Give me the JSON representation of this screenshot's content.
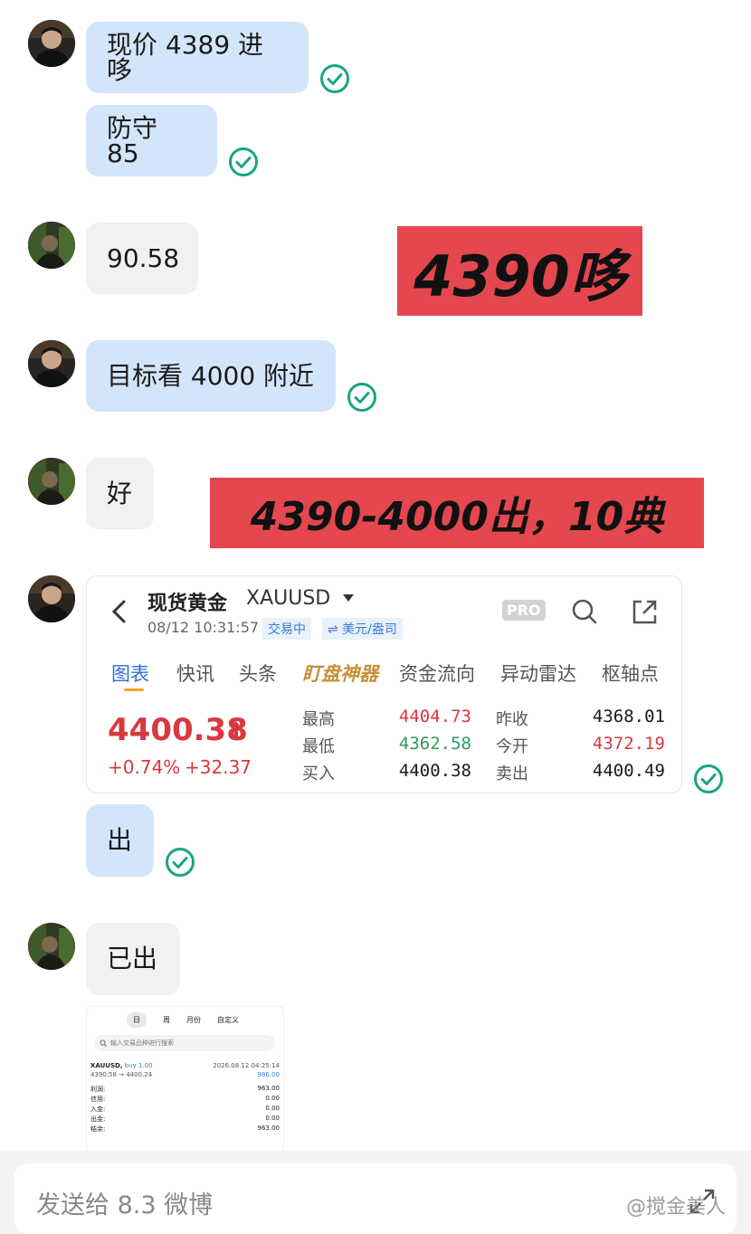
{
  "messages": {
    "m1": "现价 4389 进哆",
    "m2": "防守 85",
    "m3": "90.58",
    "m4": "目标看 4000 附近",
    "m5": "好",
    "m6": "出",
    "m7": "已出"
  },
  "banners": {
    "b1": "4390哆",
    "b2": "4390-4000出，10典"
  },
  "quote_card": {
    "title": "现货黄金",
    "symbol": "XAUUSD",
    "timestamp": "08/12 10:31:57",
    "badge_trading": "交易中",
    "badge_unit": "⇌ 美元/盎司",
    "pro_label": "PRO",
    "tabs": [
      "图表",
      "快讯",
      "头条",
      "盯盘神器",
      "资金流向",
      "异动雷达",
      "枢轴点"
    ],
    "price": "4400.38",
    "change_pct": "+0.74%",
    "change_abs": "+32.37",
    "high_label": "最高",
    "high": "4404.73",
    "low_label": "最低",
    "low": "4362.58",
    "buy_label": "买入",
    "buy": "4400.38",
    "prev_label": "昨收",
    "prev": "4368.01",
    "open_label": "今开",
    "open": "4372.19",
    "sell_label": "卖出",
    "sell": "4400.49"
  },
  "mini_screenshot": {
    "tabs": [
      "日",
      "周",
      "月份",
      "自定义"
    ],
    "search_placeholder": "输入交易品种进行搜索",
    "symbol": "XAUUSD,",
    "side": "buy 1.00",
    "datetime": "2026.08.12 04:25:14",
    "prices": "4390.58 → 4400.24",
    "profit": "986.00",
    "rows": [
      {
        "label": "利润:",
        "value": "963.00"
      },
      {
        "label": "信用:",
        "value": "0.00"
      },
      {
        "label": "入金:",
        "value": "0.00"
      },
      {
        "label": "出金:",
        "value": "0.00"
      },
      {
        "label": "结余:",
        "value": "963.00"
      }
    ]
  },
  "composer": {
    "placeholder": "发送给 8.3 微博"
  },
  "watermark": "@搅金美人",
  "colors": {
    "mine_bubble": "#d3e5fb",
    "theirs_bubble": "#f1f1f1",
    "banner": "#e4474e",
    "check": "#1aa57f",
    "up": "#d9383f",
    "down": "#2a9d5c"
  }
}
